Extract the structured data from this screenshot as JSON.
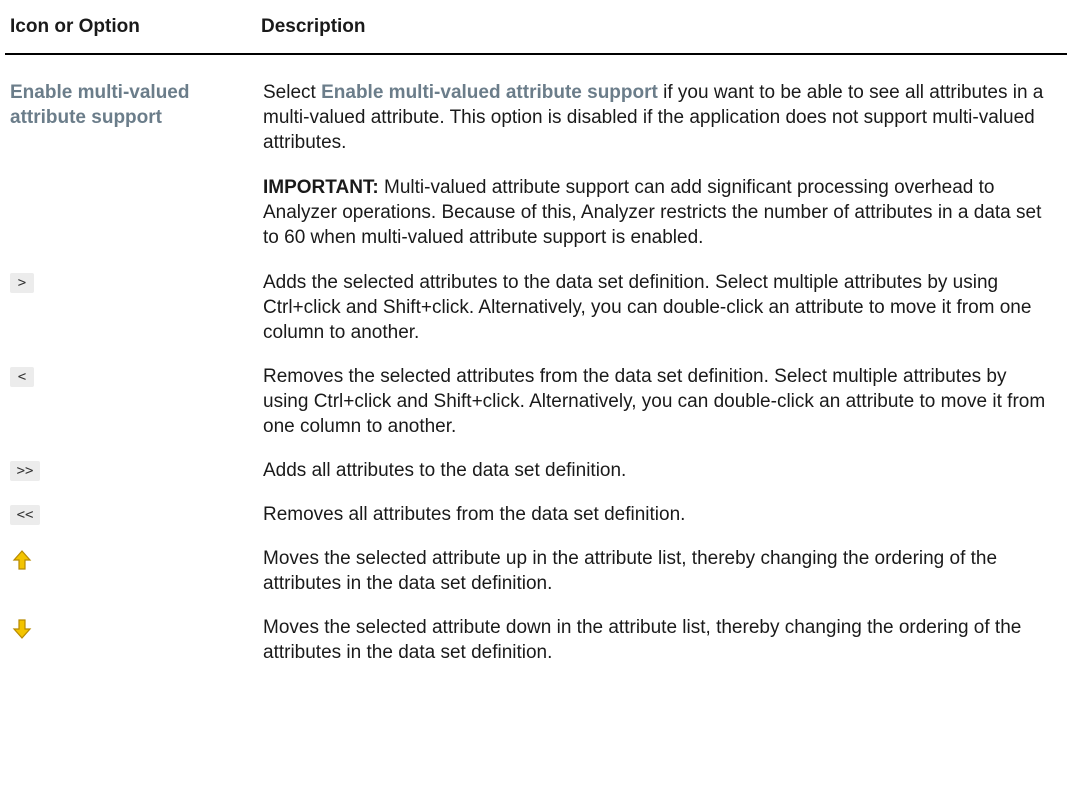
{
  "header": {
    "col1": "Icon or Option",
    "col2": "Description"
  },
  "rows": [
    {
      "option_label": "Enable multi-valued attribute support",
      "desc_prefix": "Select ",
      "desc_keyword": "Enable multi-valued attribute support",
      "desc_suffix": " if you want to be able to see all attributes in a multi-valued attribute. This option is disabled if the application does not support multi-valued attributes.",
      "important_label": "IMPORTANT:",
      "important_text": " Multi-valued attribute support can add significant processing overhead to Analyzer operations. Because of this, Analyzer restricts the number of attributes in a data set to 60 when multi-valued attribute support is enabled."
    },
    {
      "icon": "add-selected-icon",
      "glyph": ">",
      "desc": "Adds the selected attributes to the data set definition. Select multiple attributes by using Ctrl+click and Shift+click. Alternatively, you can double-click an attribute to move it from one column to another."
    },
    {
      "icon": "remove-selected-icon",
      "glyph": "<",
      "desc": "Removes the selected attributes from the data set definition. Select multiple attributes by using Ctrl+click and Shift+click. Alternatively, you can double-click an attribute to move it from one column to another."
    },
    {
      "icon": "add-all-icon",
      "glyph": ">>",
      "desc": "Adds all attributes to the data set definition."
    },
    {
      "icon": "remove-all-icon",
      "glyph": "<<",
      "desc": "Removes all attributes from the data set definition."
    },
    {
      "icon": "move-up-arrow-icon",
      "desc": "Moves the selected attribute up in the attribute list, thereby changing the ordering of the attributes in the data set definition."
    },
    {
      "icon": "move-down-arrow-icon",
      "desc": "Moves the selected attribute down in the attribute list, thereby changing the ordering of the attributes in the data set definition."
    }
  ],
  "colors": {
    "option_text": "#6b7d8a",
    "arrow_fill": "#f3c400",
    "arrow_stroke": "#b88a00",
    "icon_bg": "#ececec"
  }
}
